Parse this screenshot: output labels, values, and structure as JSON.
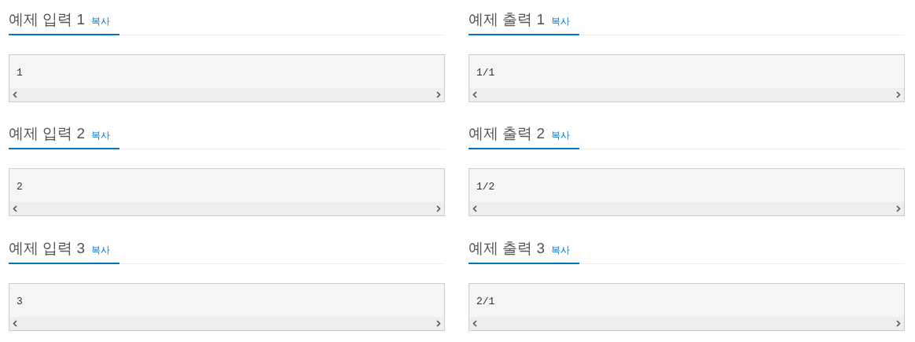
{
  "rows": [
    [
      {
        "title": "예제 입력 1",
        "copy": "복사",
        "content": "1"
      },
      {
        "title": "예제 출력 1",
        "copy": "복사",
        "content": "1/1"
      }
    ],
    [
      {
        "title": "예제 입력 2",
        "copy": "복사",
        "content": "2"
      },
      {
        "title": "예제 출력 2",
        "copy": "복사",
        "content": "1/2"
      }
    ],
    [
      {
        "title": "예제 입력 3",
        "copy": "복사",
        "content": "3"
      },
      {
        "title": "예제 출력 3",
        "copy": "복사",
        "content": "2/1"
      }
    ]
  ]
}
